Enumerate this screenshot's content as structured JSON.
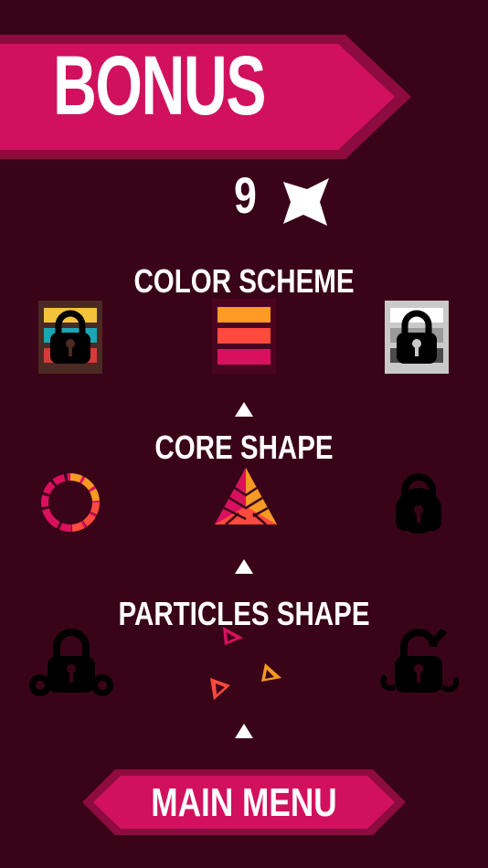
{
  "header": {
    "title": "BONUS"
  },
  "stars": {
    "count": "9"
  },
  "sections": {
    "color_scheme": {
      "title": "COLOR SCHEME"
    },
    "core_shape": {
      "title": "CORE SHAPE"
    },
    "particles_shape": {
      "title": "PARTICLES SHAPE"
    }
  },
  "footer": {
    "main_menu_label": "MAIN MENU"
  },
  "colors": {
    "background": "#3a0418",
    "banner": "#d1115d",
    "banner_dark": "#8e0b3f",
    "orange": "#ff9a22",
    "coral": "#ff4a3d",
    "pink": "#d9105e",
    "yellow": "#f5c33b",
    "teal": "#1aa7b5",
    "red": "#d53b3b"
  },
  "icons": [
    "star-icon",
    "lock-icon",
    "triangle-up-icon"
  ]
}
